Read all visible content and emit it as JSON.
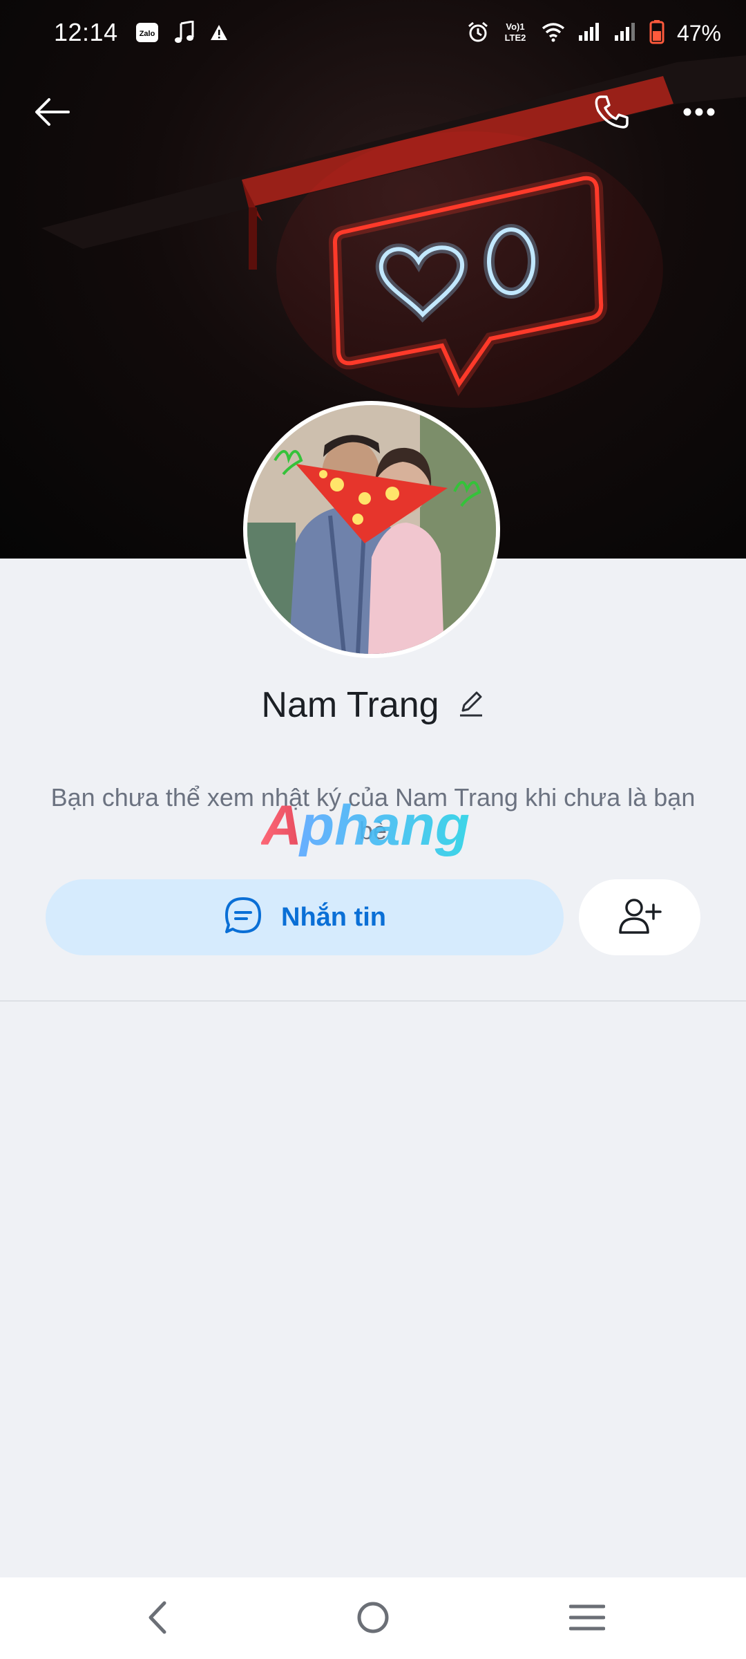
{
  "status_bar": {
    "time": "12:14",
    "left_icons": [
      "zalo-icon",
      "music-note-icon",
      "warning-icon"
    ],
    "right_icons": [
      "alarm-icon",
      "volte-icon",
      "wifi-icon",
      "signal-icon",
      "signal-icon",
      "battery-icon"
    ],
    "volte_label": "Vo) LTE2",
    "zalo_label": "Zalo",
    "battery": "47%"
  },
  "header": {
    "back_icon": "arrow-left-icon",
    "call_icon": "phone-icon",
    "more_icon": "more-dots-icon"
  },
  "profile": {
    "name": "Nam Trang",
    "edit_icon": "pencil-icon",
    "notice": "Bạn chưa thể xem nhật ký của Nam Trang khi chưa là bạn bè",
    "watermark": "Aphang"
  },
  "actions": {
    "message_label": "Nhắn tin",
    "message_icon": "chat-bubble-icon",
    "add_friend_icon": "add-friend-icon"
  },
  "colors": {
    "accent": "#0a6fd6",
    "button_bg": "#d6ebfd",
    "page_bg": "#eff1f5",
    "neon_red": "#ff2a2a",
    "neon_blue": "#bfe6ff"
  },
  "nav": {
    "icons": [
      "back-nav-icon",
      "home-nav-icon",
      "recents-nav-icon"
    ]
  }
}
